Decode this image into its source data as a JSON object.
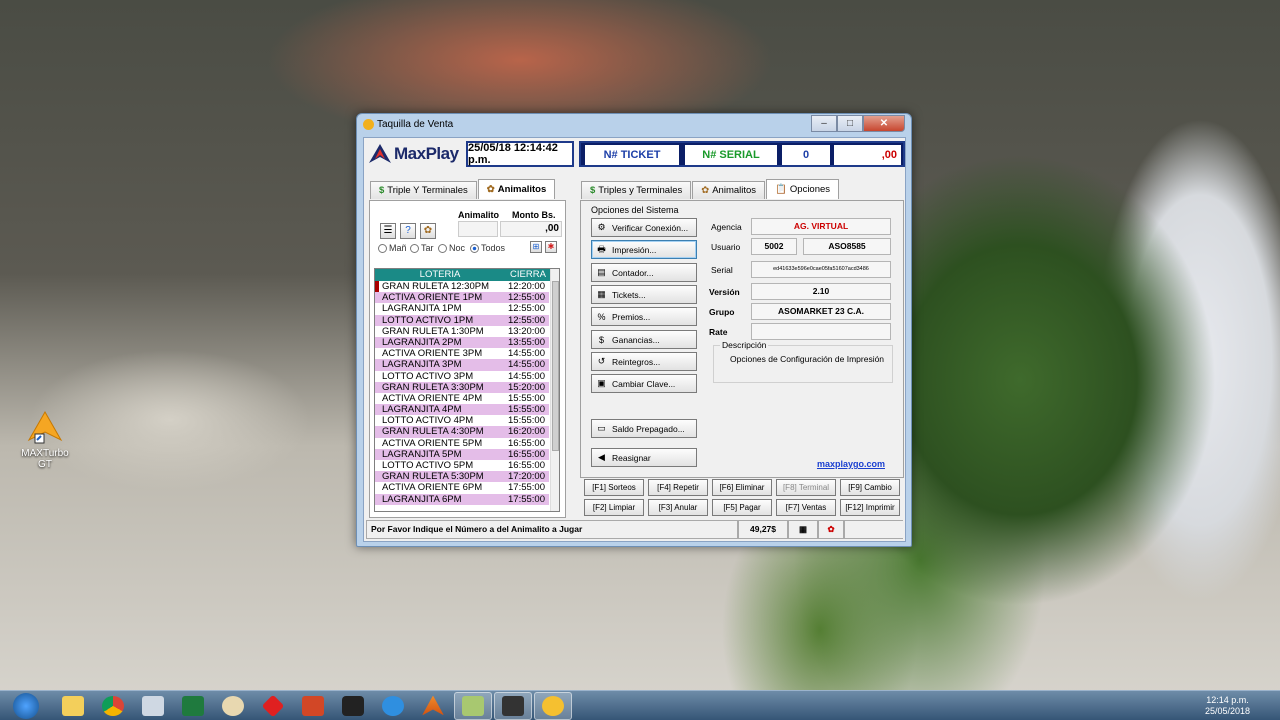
{
  "desktop": {
    "icon_label": "MAXTurbo GT"
  },
  "window": {
    "title": "Taquilla de Venta",
    "min": "–",
    "max": "□",
    "close": "✕"
  },
  "header": {
    "logo": "MaxPlay",
    "datetime": "25/05/18 12:14:42 p.m.",
    "ticket_label": "N# TICKET",
    "serial_label": "N# SERIAL",
    "count": "0",
    "amount": ",00"
  },
  "left": {
    "tabs": [
      "Triple Y Terminales",
      "Animalitos"
    ],
    "animalito_label": "Animalito",
    "monto_label": "Monto Bs.",
    "monto_value": ",00",
    "filters": [
      "Mañ",
      "Tar",
      "Noc",
      "Todos"
    ],
    "columns": [
      "LOTERIA",
      "CIERRA"
    ],
    "rows": [
      [
        "GRAN RULETA 12:30PM",
        "12:20:00"
      ],
      [
        "ACTIVA ORIENTE 1PM",
        "12:55:00"
      ],
      [
        "LAGRANJITA 1PM",
        "12:55:00"
      ],
      [
        "LOTTO ACTIVO 1PM",
        "12:55:00"
      ],
      [
        "GRAN RULETA 1:30PM",
        "13:20:00"
      ],
      [
        "LAGRANJITA 2PM",
        "13:55:00"
      ],
      [
        "ACTIVA ORIENTE 3PM",
        "14:55:00"
      ],
      [
        "LAGRANJITA 3PM",
        "14:55:00"
      ],
      [
        "LOTTO ACTIVO 3PM",
        "14:55:00"
      ],
      [
        "GRAN RULETA 3:30PM",
        "15:20:00"
      ],
      [
        "ACTIVA ORIENTE 4PM",
        "15:55:00"
      ],
      [
        "LAGRANJITA 4PM",
        "15:55:00"
      ],
      [
        "LOTTO ACTIVO 4PM",
        "15:55:00"
      ],
      [
        "GRAN RULETA 4:30PM",
        "16:20:00"
      ],
      [
        "ACTIVA ORIENTE 5PM",
        "16:55:00"
      ],
      [
        "LAGRANJITA 5PM",
        "16:55:00"
      ],
      [
        "LOTTO ACTIVO 5PM",
        "16:55:00"
      ],
      [
        "GRAN RULETA 5:30PM",
        "17:20:00"
      ],
      [
        "ACTIVA ORIENTE 6PM",
        "17:55:00"
      ],
      [
        "LAGRANJITA 6PM",
        "17:55:00"
      ]
    ]
  },
  "right": {
    "tabs": [
      "Triples y Terminales",
      "Animalitos",
      "Opciones"
    ],
    "group_title": "Opciones del Sistema",
    "buttons": [
      "Verificar Conexión...",
      "Impresión...",
      "Contador...",
      "Tickets...",
      "Premios...",
      "Ganancias...",
      "Reintegros...",
      "Cambiar Clave...",
      "Saldo Prepagado...",
      "Reasignar"
    ],
    "fields": {
      "agencia_label": "Agencia",
      "agencia": "AG. VIRTUAL",
      "usuario_label": "Usuario",
      "usuario_id": "5002",
      "usuario": "ASO8585",
      "serial_label": "Serial",
      "serial": "ed41633e596e0cae05fa51607acd3486",
      "version_label": "Versión",
      "version": "2.10",
      "grupo_label": "Grupo",
      "grupo": "ASOMARKET 23 C.A.",
      "rate_label": "Rate",
      "rate": "",
      "desc_label": "Descripción",
      "desc": "Opciones de Configuración de Impresión"
    },
    "link": "maxplaygo.com"
  },
  "fkeys": [
    "[F1] Sorteos",
    "[F4] Repetir",
    "[F6] Eliminar",
    "[F8] Terminal",
    "[F9] Cambio",
    "[F2] Limpiar",
    "[F3] Anular",
    "[F5] Pagar",
    "[F7] Ventas",
    "[F12] Imprimir"
  ],
  "status": {
    "message": "Por Favor Indique el Número a del Animalito a Jugar",
    "balance": "49,27$"
  },
  "taskbar": {
    "time": "12:14 p.m.",
    "date": "25/05/2018"
  }
}
